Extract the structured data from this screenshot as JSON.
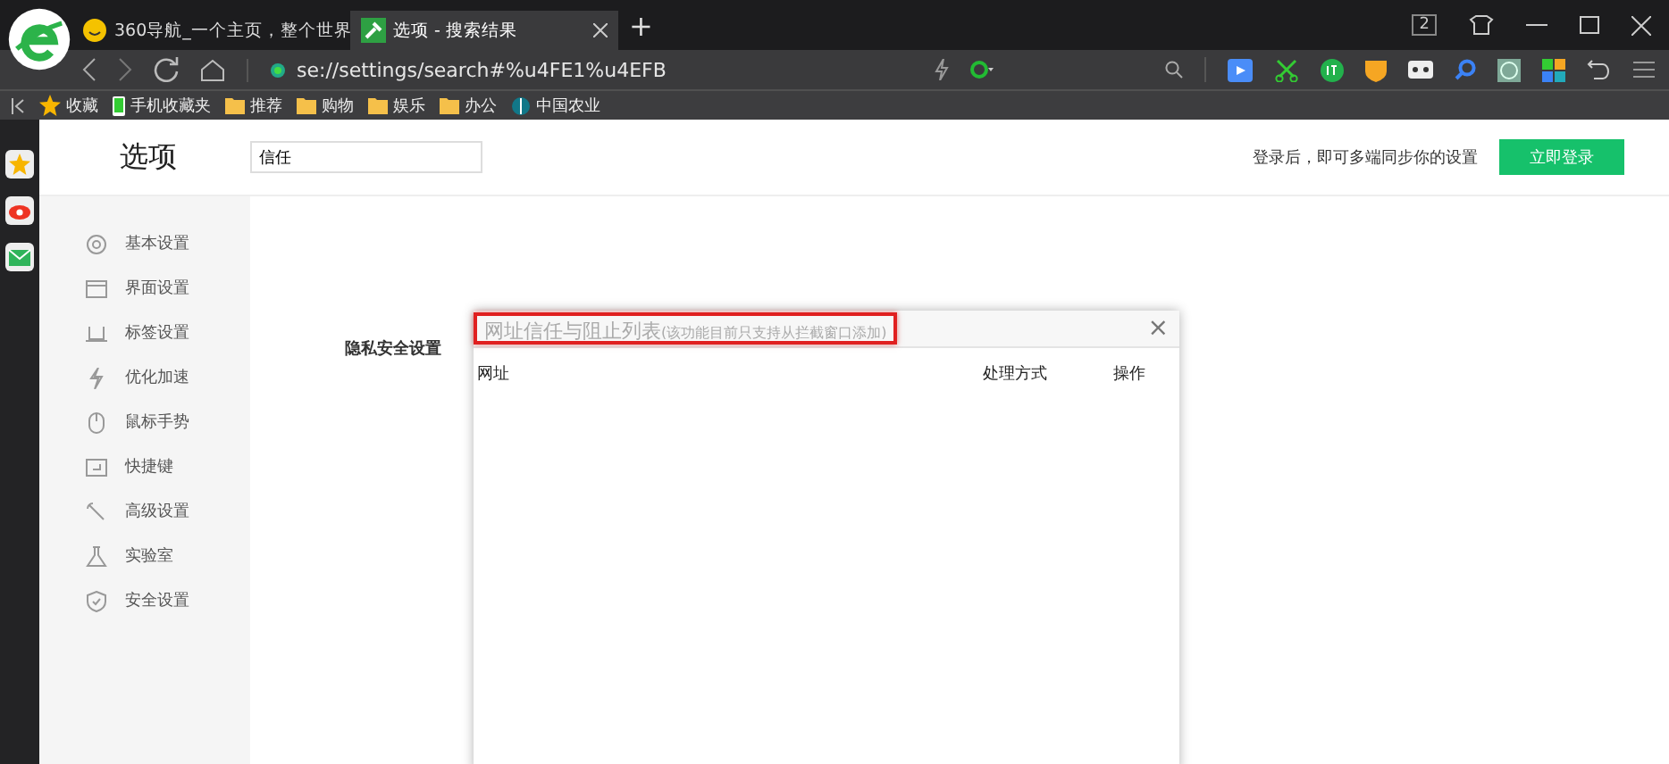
{
  "browser": {
    "tabs": [
      {
        "label": "360导航_一个主页，整个世界",
        "selected": false
      },
      {
        "label": "选项 - 搜索结果",
        "selected": true
      }
    ],
    "new_tab": "+",
    "tab_count": "2",
    "address": "se://settings/search#%u4FE1%u4EFB",
    "bookmarks": [
      {
        "kind": "star",
        "label": "收藏"
      },
      {
        "kind": "phone",
        "label": "手机收藏夹"
      },
      {
        "kind": "folder",
        "label": "推荐"
      },
      {
        "kind": "folder",
        "label": "购物"
      },
      {
        "kind": "folder",
        "label": "娱乐"
      },
      {
        "kind": "folder",
        "label": "办公"
      },
      {
        "kind": "globe",
        "label": "中国农业"
      }
    ]
  },
  "header": {
    "title": "选项",
    "search": {
      "value": "信任"
    },
    "sync_text": "登录后，即可多端同步你的设置",
    "login_button": "立即登录"
  },
  "sidebar": {
    "items": [
      {
        "kind": "gear",
        "label": "基本设置"
      },
      {
        "kind": "window",
        "label": "界面设置"
      },
      {
        "kind": "tab",
        "label": "标签设置"
      },
      {
        "kind": "bolt",
        "label": "优化加速"
      },
      {
        "kind": "mouse",
        "label": "鼠标手势"
      },
      {
        "kind": "key",
        "label": "快捷键"
      },
      {
        "kind": "wrench",
        "label": "高级设置"
      },
      {
        "kind": "flask",
        "label": "实验室"
      },
      {
        "kind": "shield",
        "label": "安全设置"
      }
    ]
  },
  "section_label": "隐私安全设置",
  "dialog": {
    "title": "网址信任与阻止列表",
    "note": "(该功能目前只支持从拦截窗口添加)",
    "close": "×",
    "columns": [
      "网址",
      "处理方式",
      "操作"
    ]
  }
}
